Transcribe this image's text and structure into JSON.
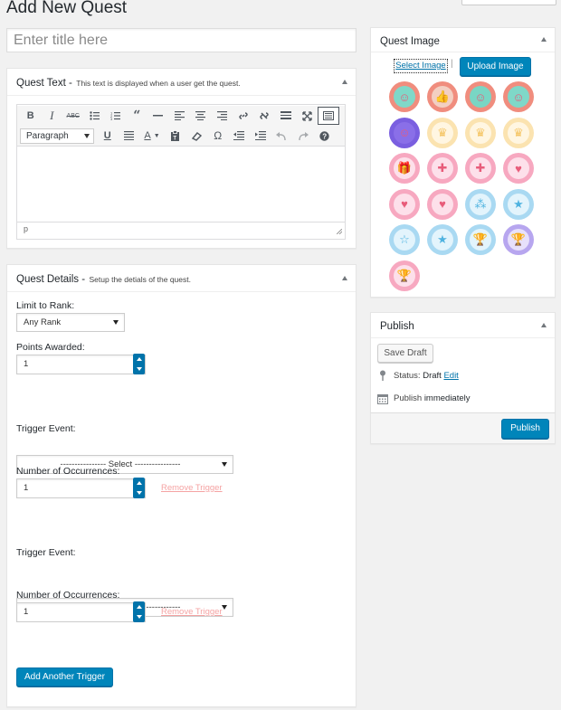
{
  "page": {
    "title": "Add New Quest"
  },
  "title_field": {
    "placeholder": "Enter title here"
  },
  "quest_text": {
    "heading": "Quest Text -",
    "subheading": "This text is displayed when a user get the quest.",
    "paragraph_select": "Paragraph",
    "status_path": "p",
    "toolbar_row1": [
      "bold-icon",
      "italic-icon",
      "strikethrough-icon",
      "bullet-list-icon",
      "numbered-list-icon",
      "blockquote-icon",
      "horizontal-line-icon",
      "align-left-icon",
      "align-center-icon",
      "align-right-icon",
      "insert-link-icon",
      "remove-link-icon",
      "read-more-icon",
      "fullscreen-icon",
      "toolbar-toggle-icon"
    ],
    "toolbar_row2": [
      "underline-icon",
      "justify-icon",
      "text-color-icon",
      "paste-as-text-icon",
      "clear-formatting-icon",
      "special-character-icon",
      "outdent-icon",
      "indent-icon",
      "undo-icon",
      "redo-icon",
      "help-icon"
    ]
  },
  "quest_details": {
    "heading": "Quest Details -",
    "subheading": "Setup the detials of the quest.",
    "limit_label": "Limit to Rank:",
    "limit_value": "Any Rank",
    "points_label": "Points Awarded:",
    "points_value": "1",
    "triggers": [
      {
        "event_label": "Trigger Event:",
        "event_value": "---------------- Select ----------------",
        "occ_label": "Number of Occurrences:",
        "occ_value": "1",
        "remove_label": "Remove Trigger"
      },
      {
        "event_label": "Trigger Event:",
        "event_value": "---------------- Select ----------------",
        "occ_label": "Number of Occurrences:",
        "occ_value": "1",
        "remove_label": "Remove Trigger"
      }
    ],
    "add_trigger_label": "Add Another Trigger"
  },
  "quest_image": {
    "heading": "Quest Image",
    "select_label": "Select Image",
    "separator": "|",
    "upload_label": "Upload Image",
    "icons": [
      {
        "name": "green-monster-badge-icon",
        "glyph": "☺",
        "ring": "#f08d7e",
        "fill": "#7fd8c8"
      },
      {
        "name": "thumbs-up-badge-icon",
        "glyph": "👍",
        "ring": "#f08d7e",
        "fill": "#f3cfc2"
      },
      {
        "name": "blue-monster-badge-icon",
        "glyph": "☺",
        "ring": "#f08d7e",
        "fill": "#79d6c4"
      },
      {
        "name": "teal-monster-badge-icon",
        "glyph": "☺",
        "ring": "#f08d7e",
        "fill": "#7fd8c8"
      },
      {
        "name": "purple-monster-badge-icon",
        "glyph": "☺",
        "ring": "#7a5fe0",
        "fill": "#8a6fe8"
      },
      {
        "name": "crown-badge-icon",
        "glyph": "♛",
        "ring": "#fbe3b0",
        "fill": "#fff6e2"
      },
      {
        "name": "crown-badge-icon",
        "glyph": "♛",
        "ring": "#fbe3b0",
        "fill": "#fff6e2"
      },
      {
        "name": "crown-badge-icon",
        "glyph": "♛",
        "ring": "#fbe3b0",
        "fill": "#fff6e2"
      },
      {
        "name": "gift-badge-icon",
        "glyph": "🎁",
        "ring": "#f7a8c0",
        "fill": "#fde0ea"
      },
      {
        "name": "medkit-badge-icon",
        "glyph": "✚",
        "ring": "#f7a8c0",
        "fill": "#fde0ea"
      },
      {
        "name": "plus-badge-icon",
        "glyph": "✚",
        "ring": "#f7a8c0",
        "fill": "#fde0ea"
      },
      {
        "name": "heart-minus-badge-icon",
        "glyph": "♥",
        "ring": "#f7a8c0",
        "fill": "#fde0ea"
      },
      {
        "name": "heart-plus-badge-icon",
        "glyph": "♥",
        "ring": "#f7a8c0",
        "fill": "#fde0ea"
      },
      {
        "name": "heart-badge-icon",
        "glyph": "♥",
        "ring": "#f7a8c0",
        "fill": "#fde0ea"
      },
      {
        "name": "three-stars-badge-icon",
        "glyph": "⁂",
        "ring": "#a9d9f2",
        "fill": "#e3f4fc"
      },
      {
        "name": "star-badge-icon",
        "glyph": "★",
        "ring": "#a9d9f2",
        "fill": "#e3f4fc"
      },
      {
        "name": "star-outline-badge-icon",
        "glyph": "☆",
        "ring": "#a9d9f2",
        "fill": "#e3f4fc"
      },
      {
        "name": "star-badge-icon",
        "glyph": "★",
        "ring": "#a9d9f2",
        "fill": "#e3f4fc"
      },
      {
        "name": "trophy-badge-icon",
        "glyph": "🏆",
        "ring": "#a9d9f2",
        "fill": "#e3f4fc"
      },
      {
        "name": "trophy-purple-badge-icon",
        "glyph": "🏆",
        "ring": "#b7a6ef",
        "fill": "#e7e0fb"
      },
      {
        "name": "trophy-pink-badge-icon",
        "glyph": "🏆",
        "ring": "#f7a8c0",
        "fill": "#fde0ea"
      }
    ]
  },
  "publish": {
    "heading": "Publish",
    "save_draft_label": "Save Draft",
    "status_label": "Status:",
    "status_value": "Draft",
    "status_edit": "Edit",
    "publish_label": "Publish",
    "publish_value": "immediately",
    "publish_button": "Publish"
  }
}
